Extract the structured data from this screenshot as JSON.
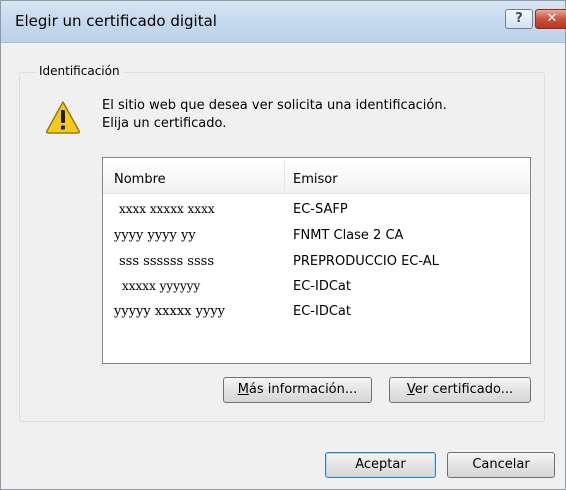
{
  "window": {
    "title": "Elegir un certificado digital",
    "help_glyph": "?",
    "close_glyph": "✕"
  },
  "group": {
    "label": "Identificación"
  },
  "message": {
    "line1": "El sitio web que desea ver solicita una identificación.",
    "line2": "Elija un certificado."
  },
  "list": {
    "columns": {
      "name": "Nombre",
      "issuer": "Emisor"
    },
    "rows": [
      {
        "name": "xxxx  xxxxx xxxx",
        "issuer": "EC-SAFP"
      },
      {
        "name": "yyyy yyyy yy",
        "issuer": "FNMT Clase 2 CA"
      },
      {
        "name": "sss ssssss ssss",
        "issuer": "PREPRODUCCIO EC-AL"
      },
      {
        "name": "xxxxx yyyyyy",
        "issuer": "EC-IDCat"
      },
      {
        "name": "yyyyy xxxxx  yyyy",
        "issuer": "EC-IDCat"
      }
    ]
  },
  "buttons": {
    "more_info_accel": "M",
    "more_info_rest": "ás información...",
    "view_cert_accel": "V",
    "view_cert_rest": "er certificado...",
    "accept": "Aceptar",
    "cancel": "Cancelar"
  },
  "icons": {
    "warning": "warning-icon",
    "help": "help-icon",
    "close": "close-icon"
  },
  "colors": {
    "warning_fill": "#f5c91d",
    "close_button": "#c75340",
    "default_button_border": "#3c7fb1"
  }
}
